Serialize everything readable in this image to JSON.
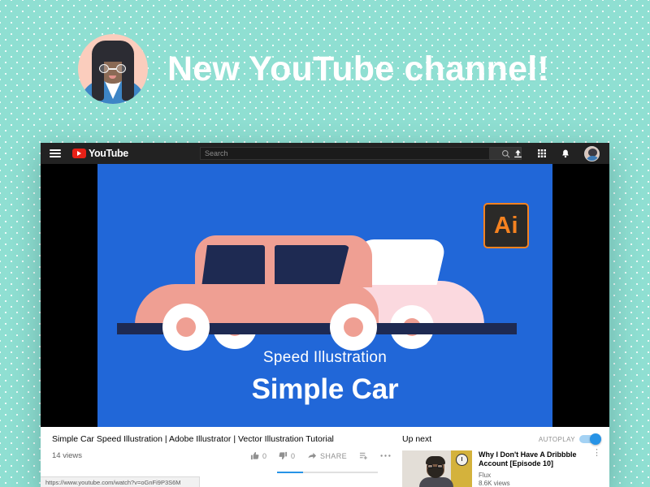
{
  "promo": {
    "title": "New YouTube channel!",
    "avatar_alt": "illustrated-woman-with-glasses-avatar"
  },
  "colors": {
    "background_teal": "#8fdfd2",
    "video_blue": "#2167d8",
    "car_pink": "#ef9f93",
    "car_navy": "#1e2a52",
    "youtube_red": "#e62117",
    "illustrator_orange": "#f58220",
    "autoplay_blue": "#2793e6"
  },
  "browser": {
    "status_url": "https://www.youtube.com/watch?v=oGnFi9P3S6M"
  },
  "masthead": {
    "menu_icon": "hamburger-icon",
    "logo_text": "YouTube",
    "search_placeholder": "Search",
    "search_value": "",
    "search_button_icon": "search-icon",
    "upload_icon": "upload-icon",
    "apps_icon": "apps-grid-icon",
    "notifications_icon": "bell-icon",
    "account_icon": "account-avatar"
  },
  "video": {
    "badge": "Ai",
    "caption_sub": "Speed Illustration",
    "caption_main": "Simple Car"
  },
  "primary": {
    "title": "Simple Car Speed Illustration | Adobe Illustrator | Vector Illustration Tutorial",
    "views": "14 views",
    "like_count": "0",
    "dislike_count": "0",
    "share_label": "SHARE",
    "like_icon": "thumbs-up-icon",
    "dislike_icon": "thumbs-down-icon",
    "share_icon": "share-arrow-icon",
    "save_icon": "add-to-playlist-icon",
    "more_icon": "more-horizontal-icon"
  },
  "secondary": {
    "up_next_label": "Up next",
    "autoplay_label": "AUTOPLAY",
    "autoplay_on": true,
    "item": {
      "title": "Why I Don't Have A Dribbble Account [Episode 10]",
      "channel": "Flux",
      "views": "8.6K views",
      "more_icon": "more-vertical-icon"
    }
  }
}
